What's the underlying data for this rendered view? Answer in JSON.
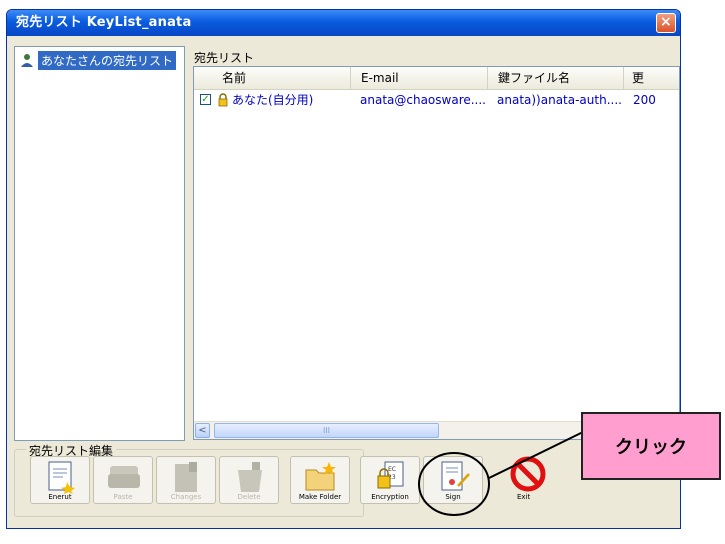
{
  "window": {
    "title": "宛先リスト KeyList_anata",
    "close_glyph": "×"
  },
  "tree": {
    "items": [
      {
        "label": "あなたさんの宛先リスト",
        "icon": "person-icon"
      }
    ]
  },
  "list": {
    "section_label": "宛先リスト",
    "columns": [
      "名前",
      "E-mail",
      "鍵ファイル名",
      "更"
    ],
    "rows": [
      {
        "checked": true,
        "name": "あなた(自分用)",
        "email": "anata@chaosware....",
        "keyfile": "anata))anata-auth....",
        "updated": "200"
      }
    ],
    "scroll_left_glyph": "<",
    "scroll_thumb_grip": "III"
  },
  "toolbar": {
    "group_label": "宛先リスト編集",
    "buttons": [
      {
        "caption": "Enerut",
        "icon": "new-entry-icon",
        "enabled": true
      },
      {
        "caption": "Paste",
        "icon": "sofa-icon",
        "enabled": false
      },
      {
        "caption": "Changes",
        "icon": "doc-edit-icon",
        "enabled": false
      },
      {
        "caption": "Delete",
        "icon": "trash-icon",
        "enabled": false
      },
      {
        "caption": "Make Folder",
        "icon": "new-folder-icon",
        "enabled": true
      },
      {
        "caption": "Encryption",
        "icon": "encryption-icon",
        "enabled": true
      },
      {
        "caption": "Sign",
        "icon": "sign-icon",
        "enabled": true
      }
    ],
    "exit": {
      "caption": "Exit",
      "icon": "no-entry-icon"
    }
  },
  "annotation": {
    "callout_text": "クリック"
  },
  "colors": {
    "title_bar": "#0a5be0",
    "selection": "#316ac5",
    "callout_fill": "#ff9ecf",
    "link_text": "#0000c0"
  }
}
